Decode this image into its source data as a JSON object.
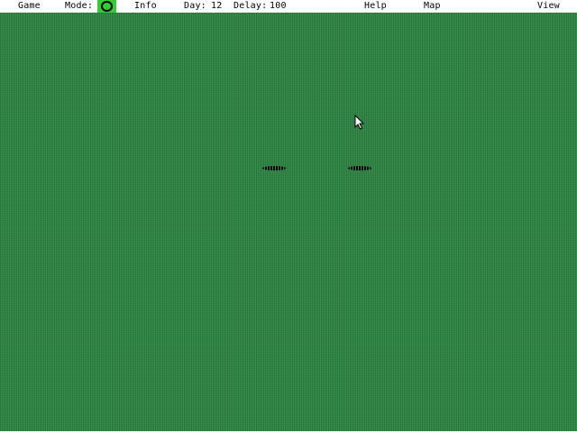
{
  "menubar": {
    "game": "Game",
    "mode_label": "Mode:",
    "mode_icon": "circle-mode-icon",
    "info": "Info",
    "day_label": "Day:",
    "day_value": "12",
    "delay_label": "Delay:",
    "delay_value": "100",
    "help": "Help",
    "map": "Map",
    "view": "View"
  },
  "colors": {
    "field_green": "#2f8a46",
    "mode_button_green": "#33cc33",
    "menubar_bg": "#ffffff"
  },
  "playfield": {
    "units": [
      "unit",
      "unit"
    ]
  }
}
